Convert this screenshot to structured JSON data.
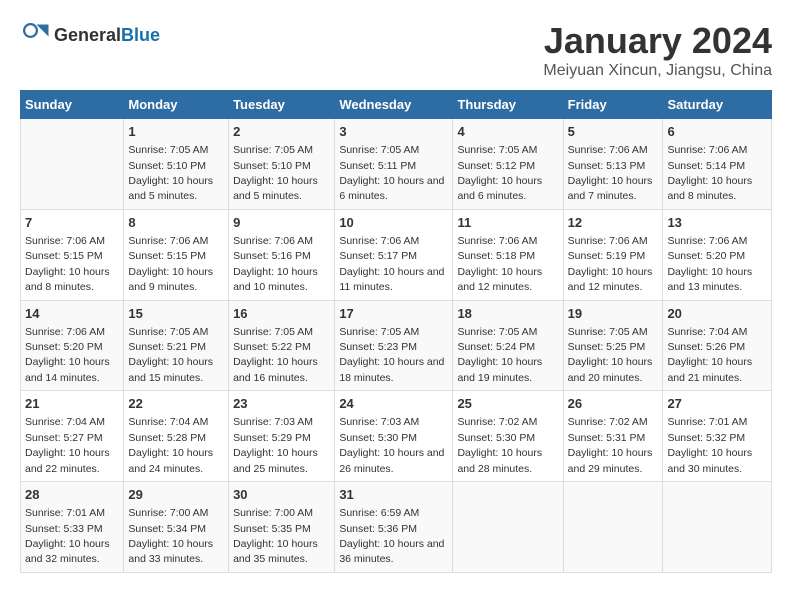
{
  "header": {
    "logo_general": "General",
    "logo_blue": "Blue",
    "month_title": "January 2024",
    "location": "Meiyuan Xincun, Jiangsu, China"
  },
  "weekdays": [
    "Sunday",
    "Monday",
    "Tuesday",
    "Wednesday",
    "Thursday",
    "Friday",
    "Saturday"
  ],
  "weeks": [
    [
      null,
      {
        "day": "1",
        "sunrise": "7:05 AM",
        "sunset": "5:10 PM",
        "daylight": "10 hours and 5 minutes."
      },
      {
        "day": "2",
        "sunrise": "7:05 AM",
        "sunset": "5:10 PM",
        "daylight": "10 hours and 5 minutes."
      },
      {
        "day": "3",
        "sunrise": "7:05 AM",
        "sunset": "5:11 PM",
        "daylight": "10 hours and 6 minutes."
      },
      {
        "day": "4",
        "sunrise": "7:05 AM",
        "sunset": "5:12 PM",
        "daylight": "10 hours and 6 minutes."
      },
      {
        "day": "5",
        "sunrise": "7:06 AM",
        "sunset": "5:13 PM",
        "daylight": "10 hours and 7 minutes."
      },
      {
        "day": "6",
        "sunrise": "7:06 AM",
        "sunset": "5:14 PM",
        "daylight": "10 hours and 8 minutes."
      }
    ],
    [
      {
        "day": "7",
        "sunrise": "7:06 AM",
        "sunset": "5:15 PM",
        "daylight": "10 hours and 8 minutes."
      },
      {
        "day": "8",
        "sunrise": "7:06 AM",
        "sunset": "5:15 PM",
        "daylight": "10 hours and 9 minutes."
      },
      {
        "day": "9",
        "sunrise": "7:06 AM",
        "sunset": "5:16 PM",
        "daylight": "10 hours and 10 minutes."
      },
      {
        "day": "10",
        "sunrise": "7:06 AM",
        "sunset": "5:17 PM",
        "daylight": "10 hours and 11 minutes."
      },
      {
        "day": "11",
        "sunrise": "7:06 AM",
        "sunset": "5:18 PM",
        "daylight": "10 hours and 12 minutes."
      },
      {
        "day": "12",
        "sunrise": "7:06 AM",
        "sunset": "5:19 PM",
        "daylight": "10 hours and 12 minutes."
      },
      {
        "day": "13",
        "sunrise": "7:06 AM",
        "sunset": "5:20 PM",
        "daylight": "10 hours and 13 minutes."
      }
    ],
    [
      {
        "day": "14",
        "sunrise": "7:06 AM",
        "sunset": "5:20 PM",
        "daylight": "10 hours and 14 minutes."
      },
      {
        "day": "15",
        "sunrise": "7:05 AM",
        "sunset": "5:21 PM",
        "daylight": "10 hours and 15 minutes."
      },
      {
        "day": "16",
        "sunrise": "7:05 AM",
        "sunset": "5:22 PM",
        "daylight": "10 hours and 16 minutes."
      },
      {
        "day": "17",
        "sunrise": "7:05 AM",
        "sunset": "5:23 PM",
        "daylight": "10 hours and 18 minutes."
      },
      {
        "day": "18",
        "sunrise": "7:05 AM",
        "sunset": "5:24 PM",
        "daylight": "10 hours and 19 minutes."
      },
      {
        "day": "19",
        "sunrise": "7:05 AM",
        "sunset": "5:25 PM",
        "daylight": "10 hours and 20 minutes."
      },
      {
        "day": "20",
        "sunrise": "7:04 AM",
        "sunset": "5:26 PM",
        "daylight": "10 hours and 21 minutes."
      }
    ],
    [
      {
        "day": "21",
        "sunrise": "7:04 AM",
        "sunset": "5:27 PM",
        "daylight": "10 hours and 22 minutes."
      },
      {
        "day": "22",
        "sunrise": "7:04 AM",
        "sunset": "5:28 PM",
        "daylight": "10 hours and 24 minutes."
      },
      {
        "day": "23",
        "sunrise": "7:03 AM",
        "sunset": "5:29 PM",
        "daylight": "10 hours and 25 minutes."
      },
      {
        "day": "24",
        "sunrise": "7:03 AM",
        "sunset": "5:30 PM",
        "daylight": "10 hours and 26 minutes."
      },
      {
        "day": "25",
        "sunrise": "7:02 AM",
        "sunset": "5:30 PM",
        "daylight": "10 hours and 28 minutes."
      },
      {
        "day": "26",
        "sunrise": "7:02 AM",
        "sunset": "5:31 PM",
        "daylight": "10 hours and 29 minutes."
      },
      {
        "day": "27",
        "sunrise": "7:01 AM",
        "sunset": "5:32 PM",
        "daylight": "10 hours and 30 minutes."
      }
    ],
    [
      {
        "day": "28",
        "sunrise": "7:01 AM",
        "sunset": "5:33 PM",
        "daylight": "10 hours and 32 minutes."
      },
      {
        "day": "29",
        "sunrise": "7:00 AM",
        "sunset": "5:34 PM",
        "daylight": "10 hours and 33 minutes."
      },
      {
        "day": "30",
        "sunrise": "7:00 AM",
        "sunset": "5:35 PM",
        "daylight": "10 hours and 35 minutes."
      },
      {
        "day": "31",
        "sunrise": "6:59 AM",
        "sunset": "5:36 PM",
        "daylight": "10 hours and 36 minutes."
      },
      null,
      null,
      null
    ]
  ]
}
